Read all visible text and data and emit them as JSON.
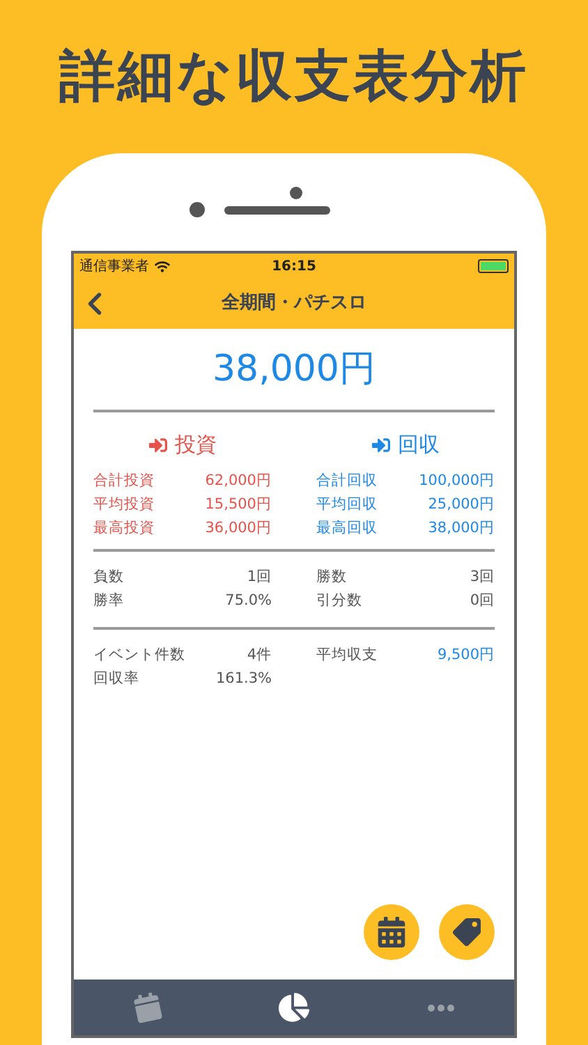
{
  "headline": "詳細な収支表分析",
  "status_bar": {
    "carrier": "通信事業者",
    "time": "16:15"
  },
  "nav": {
    "title": "全期間・パチスロ"
  },
  "total": "38,000円",
  "sections": [
    {
      "kind": "invest",
      "title": "投資",
      "rows": [
        {
          "label": "合計投資",
          "value": "62,000円"
        },
        {
          "label": "平均投資",
          "value": "15,500円"
        },
        {
          "label": "最高投資",
          "value": "36,000円"
        }
      ]
    },
    {
      "kind": "recovery",
      "title": "回収",
      "rows": [
        {
          "label": "合計回収",
          "value": "100,000円"
        },
        {
          "label": "平均回収",
          "value": "25,000円"
        },
        {
          "label": "最高回収",
          "value": "38,000円"
        }
      ]
    }
  ],
  "stats": [
    [
      {
        "label": "負数",
        "value": "1回",
        "accent": false
      },
      {
        "label": "勝数",
        "value": "3回",
        "accent": false
      },
      {
        "label": "勝率",
        "value": "75.0%",
        "accent": false
      },
      {
        "label": "引分数",
        "value": "0回",
        "accent": false
      }
    ],
    [
      {
        "label": "イベント件数",
        "value": "4件",
        "accent": false
      },
      {
        "label": "平均収支",
        "value": "9,500円",
        "accent": true
      },
      {
        "label": "回収率",
        "value": "161.3%",
        "accent": false
      }
    ]
  ],
  "fabs": [
    {
      "kind": "calendar"
    },
    {
      "kind": "tag"
    }
  ],
  "tabs": [
    {
      "kind": "calendar",
      "selected": false
    },
    {
      "kind": "chart",
      "selected": true
    },
    {
      "kind": "more",
      "selected": false
    }
  ]
}
